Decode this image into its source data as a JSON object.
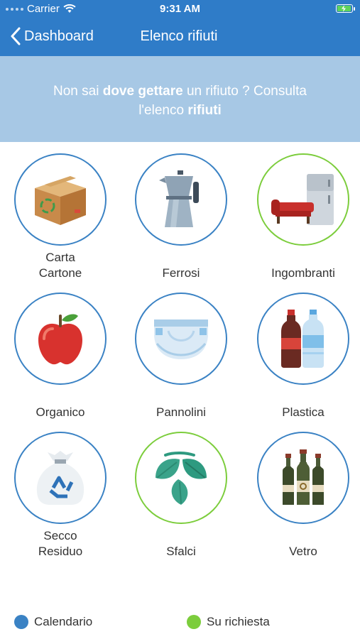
{
  "status": {
    "carrier": "Carrier",
    "time": "9:31 AM"
  },
  "nav": {
    "back_label": "Dashboard",
    "title": "Elenco rifiuti"
  },
  "banner": {
    "part1": "Non sai ",
    "bold1": "dove gettare",
    "part2": " un rifiuto ? Consulta",
    "part3": "l'elenco ",
    "bold2": "rifiuti"
  },
  "categories": [
    {
      "line1": "Carta",
      "line2": "Cartone",
      "ring": "blue",
      "icon": "cardboard-box-icon"
    },
    {
      "line1": "Ferrosi",
      "line2": "",
      "ring": "blue",
      "icon": "moka-pot-icon"
    },
    {
      "line1": "Ingombranti",
      "line2": "",
      "ring": "green",
      "icon": "sofa-fridge-icon"
    },
    {
      "line1": "Organico",
      "line2": "",
      "ring": "blue",
      "icon": "apple-icon"
    },
    {
      "line1": "Pannolini",
      "line2": "",
      "ring": "blue",
      "icon": "diaper-icon"
    },
    {
      "line1": "Plastica",
      "line2": "",
      "ring": "blue",
      "icon": "plastic-bottles-icon"
    },
    {
      "line1": "Secco",
      "line2": "Residuo",
      "ring": "blue",
      "icon": "trash-bag-icon"
    },
    {
      "line1": "Sfalci",
      "line2": "",
      "ring": "green",
      "icon": "leaves-icon"
    },
    {
      "line1": "Vetro",
      "line2": "",
      "ring": "blue",
      "icon": "glass-bottles-icon"
    }
  ],
  "legend": [
    {
      "label": "Calendario",
      "color": "#3a82c4"
    },
    {
      "label": "Su richiesta",
      "color": "#7ccd3c"
    }
  ],
  "colors": {
    "header": "#2f7cc8",
    "banner": "#a7c8e5",
    "ring_blue": "#3a82c4",
    "ring_green": "#7ccd3c"
  }
}
